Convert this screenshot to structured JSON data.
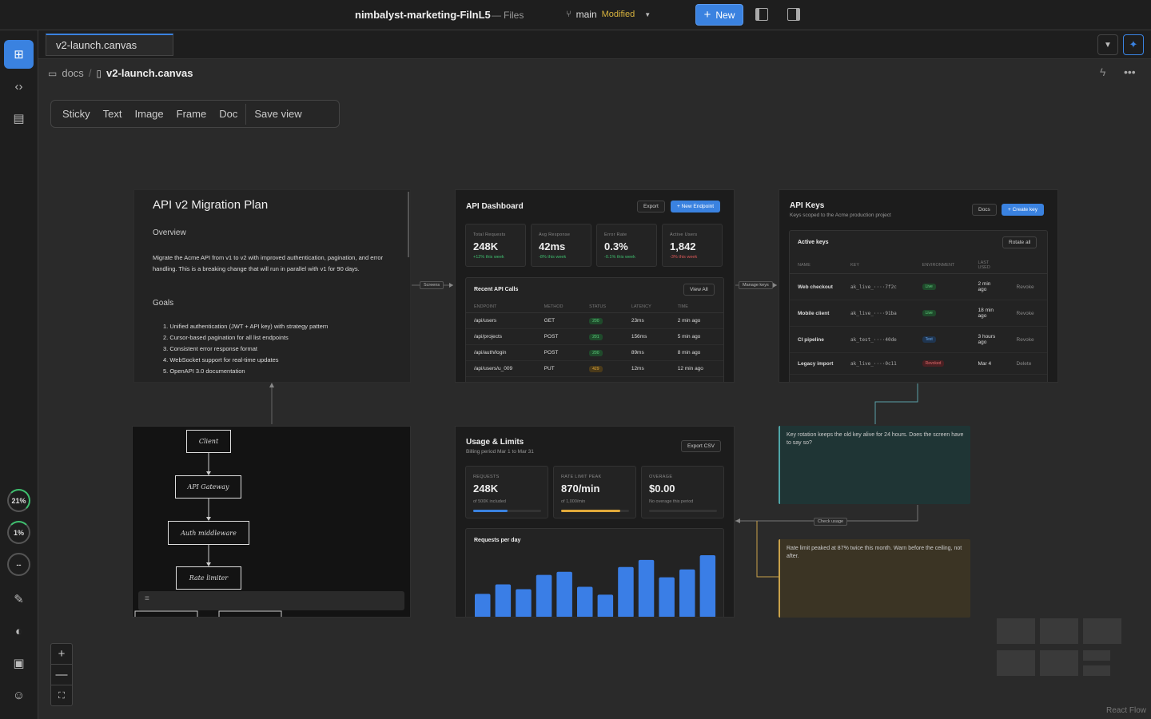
{
  "topbar": {
    "project": "nimbalyst-marketing-FilnL5",
    "separator": "—",
    "files": "Files",
    "branch": "main",
    "branch_status": "Modified",
    "new_button": "New"
  },
  "tabs": {
    "active": "v2-launch.canvas"
  },
  "breadcrumb": {
    "folder": "docs",
    "separator": "/",
    "file": "v2-launch.canvas"
  },
  "rail": {
    "progress1": "21%",
    "progress2": "1%",
    "progress3": "--"
  },
  "toolbar": {
    "sticky": "Sticky",
    "text": "Text",
    "image": "Image",
    "frame": "Frame",
    "doc": "Doc",
    "save_view": "Save view"
  },
  "doc_node": {
    "title": "API v2 Migration Plan",
    "overview_heading": "Overview",
    "overview_text": "Migrate the Acme API from v1 to v2 with improved authentication, pagination, and error handling. This is a breaking change that will run in parallel with v1 for 90 days.",
    "goals_heading": "Goals",
    "goals": [
      "1. Unified authentication (JWT + API key) with strategy pattern",
      "2. Cursor-based pagination for all list endpoints",
      "3. Consistent error response format",
      "4. WebSocket support for real-time updates",
      "5. OpenAPI 3.0 documentation"
    ]
  },
  "dashboard": {
    "title": "API Dashboard",
    "export": "Export",
    "new_endpoint": "+ New Endpoint",
    "stats": [
      {
        "label": "Total Requests",
        "value": "248K",
        "delta": "+12% this week",
        "color": "#3fbf6f"
      },
      {
        "label": "Avg Response",
        "value": "42ms",
        "delta": "-8% this week",
        "color": "#3fbf6f"
      },
      {
        "label": "Error Rate",
        "value": "0.3%",
        "delta": "-0.1% this week",
        "color": "#3fbf6f"
      },
      {
        "label": "Active Users",
        "value": "1,842",
        "delta": "-3% this week",
        "color": "#e05a5a"
      }
    ],
    "recent_title": "Recent API Calls",
    "view_all": "View All",
    "columns": [
      "Endpoint",
      "Method",
      "Status",
      "Latency",
      "Time"
    ],
    "rows": [
      [
        "/api/users",
        "GET",
        "200",
        "23ms",
        "2 min ago"
      ],
      [
        "/api/projects",
        "POST",
        "201",
        "156ms",
        "5 min ago"
      ],
      [
        "/api/auth/login",
        "POST",
        "200",
        "89ms",
        "8 min ago"
      ],
      [
        "/api/users/u_009",
        "PUT",
        "429",
        "12ms",
        "12 min ago"
      ]
    ]
  },
  "api_keys": {
    "title": "API Keys",
    "subtitle": "Keys scoped to the Acme production project",
    "docs": "Docs",
    "create": "+ Create key",
    "active_title": "Active keys",
    "rotate": "Rotate all",
    "columns": [
      "Name",
      "Key",
      "Environment",
      "Last used"
    ],
    "rows": [
      [
        "Web checkout",
        "ak_live_····7f2c",
        "Live",
        "2 min ago",
        "Revoke"
      ],
      [
        "Mobile client",
        "ak_live_····91ba",
        "Live",
        "18 min ago",
        "Revoke"
      ],
      [
        "CI pipeline",
        "ak_test_····40de",
        "Test",
        "3 hours ago",
        "Revoke"
      ],
      [
        "Legacy import",
        "ak_live_····0c11",
        "Revoked",
        "Mar 4",
        "Delete"
      ]
    ]
  },
  "diagram": {
    "nodes": [
      "Client",
      "API Gateway",
      "Auth middleware",
      "Rate limiter"
    ]
  },
  "usage": {
    "title": "Usage & Limits",
    "subtitle": "Billing period Mar 1 to Mar 31",
    "export": "Export CSV",
    "cards": [
      {
        "label": "Requests",
        "value": "248K",
        "sub": "of 500K included",
        "fill": 0.5,
        "color": "#3a82e0"
      },
      {
        "label": "Rate limit peak",
        "value": "870/min",
        "sub": "of 1,000/min",
        "fill": 0.87,
        "color": "#e0a93a"
      },
      {
        "label": "Overage",
        "value": "$0.00",
        "sub": "No overage this period",
        "fill": 0,
        "color": "#3a82e0"
      }
    ],
    "chart_title": "Requests per day"
  },
  "chart_data": {
    "type": "bar",
    "title": "Requests per day",
    "values": [
      30,
      42,
      36,
      54,
      58,
      39,
      29,
      64,
      73,
      51,
      61,
      79
    ]
  },
  "edges": {
    "screens": "Screens",
    "manage_keys": "Manage keys",
    "check_usage": "Check usage"
  },
  "notes": {
    "key_rotation": "Key rotation keeps the old key alive for 24 hours. Does the screen have to say so?",
    "rate_limit": "Rate limit peaked at 87% twice this month. Warn before the ceiling, not after."
  },
  "attribution": "React Flow"
}
